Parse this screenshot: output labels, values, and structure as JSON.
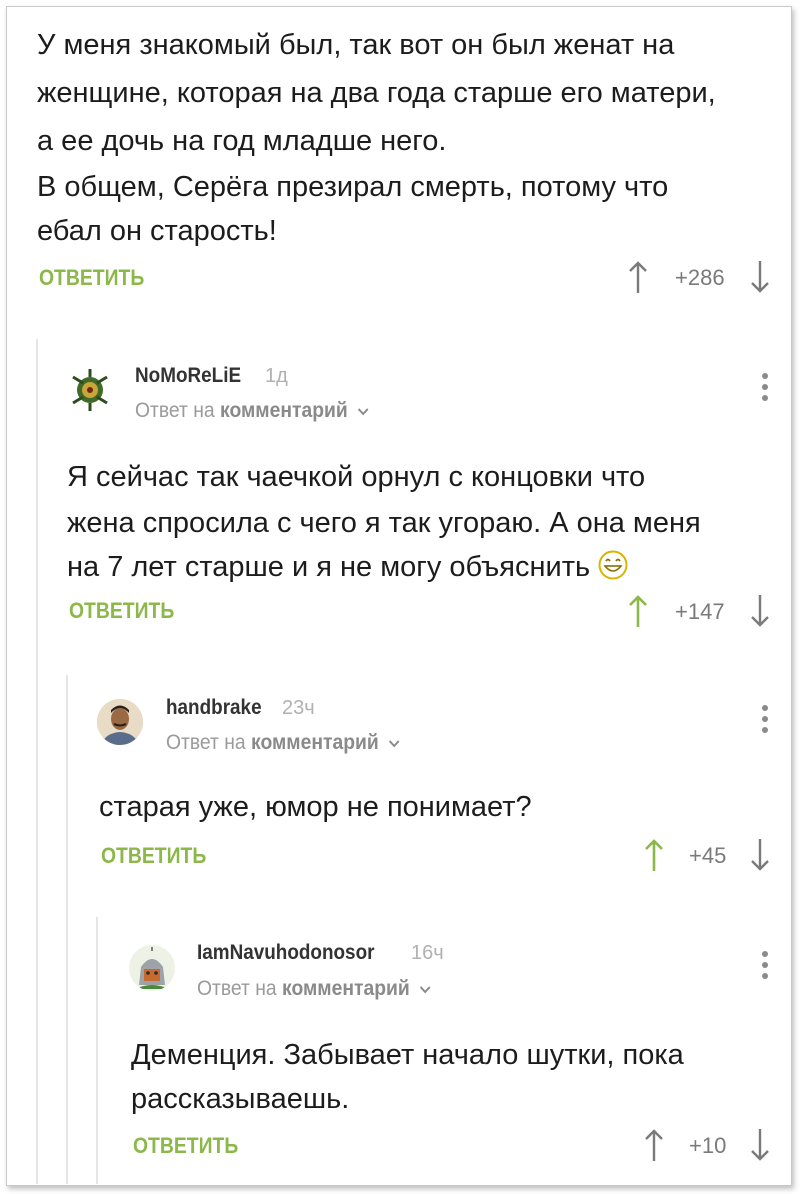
{
  "root": {
    "text_lines": [
      "У меня знакомый был, так вот он был женат на",
      "женщине, которая на два года старше его матери,",
      "а ее дочь на год младше него.",
      "В общем, Серёга презирал смерть, потому что",
      "ебал он старость!"
    ],
    "reply_label": "ОТВЕТИТЬ",
    "score": "+286"
  },
  "comments": [
    {
      "username": "NoMoReLiE",
      "time": "1д",
      "reply_to_prefix": "Ответ на",
      "reply_to_link": "комментарий",
      "text_lines": [
        "Я сейчас так чаечкой орнул с концовки что",
        "жена спросила с чего я так угораю. А она меня",
        "на 7 лет старше и я не могу объяснить"
      ],
      "emoji": "grinning-face-emoji",
      "reply_label": "ОТВЕТИТЬ",
      "score": "+147",
      "upvoted": true
    },
    {
      "username": "handbrake",
      "time": "23ч",
      "reply_to_prefix": "Ответ на",
      "reply_to_link": "комментарий",
      "text_lines": [
        "старая уже, юмор не понимает?"
      ],
      "reply_label": "ОТВЕТИТЬ",
      "score": "+45",
      "upvoted": true
    },
    {
      "username": "IamNavuhodonosor",
      "time": "16ч",
      "reply_to_prefix": "Ответ на",
      "reply_to_link": "комментарий",
      "text_lines": [
        "Деменция. Забывает начало шутки, пока",
        "рассказываешь."
      ],
      "reply_label": "ОТВЕТИТЬ",
      "score": "+10",
      "upvoted": false
    }
  ],
  "colors": {
    "accent_green": "#8cb849",
    "muted_gray": "#7a7a7a"
  }
}
